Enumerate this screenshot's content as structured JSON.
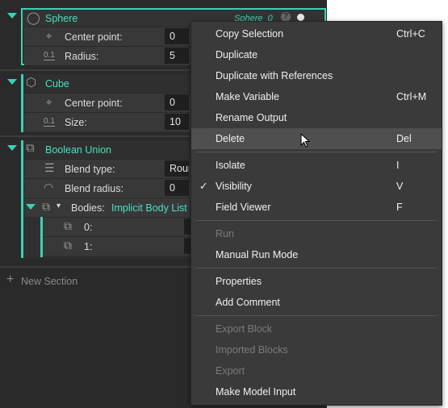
{
  "blocks": {
    "sphere": {
      "title": "Sphere",
      "output": "Sphere_0",
      "rows": [
        {
          "label": "Center point:",
          "value": "0"
        },
        {
          "label": "Radius:",
          "value": "5"
        }
      ]
    },
    "cube": {
      "title": "Cube",
      "rows": [
        {
          "label": "Center point:",
          "value": "0"
        },
        {
          "label": "Size:",
          "value": "10"
        }
      ]
    },
    "boolean": {
      "title": "Boolean Union",
      "rows": [
        {
          "label": "Blend type:",
          "value": "Roun"
        },
        {
          "label": "Blend radius:",
          "value": "0"
        }
      ],
      "bodies_label": "Bodies:",
      "bodies_type": "Implicit Body List",
      "items": [
        {
          "label": "0:"
        },
        {
          "label": "1:"
        }
      ]
    }
  },
  "small_label": "0.1",
  "new_section": "New Section",
  "menu": {
    "items": [
      {
        "label": "Copy Selection",
        "shortcut": "Ctrl+C"
      },
      {
        "label": "Duplicate",
        "shortcut": ""
      },
      {
        "label": "Duplicate with References",
        "shortcut": ""
      },
      {
        "label": "Make Variable",
        "shortcut": "Ctrl+M"
      },
      {
        "label": "Rename Output",
        "shortcut": ""
      },
      {
        "label": "Delete",
        "shortcut": "Del"
      },
      {
        "label": "Isolate",
        "shortcut": "I"
      },
      {
        "label": "Visibility",
        "shortcut": "V"
      },
      {
        "label": "Field Viewer",
        "shortcut": "F"
      },
      {
        "label": "Run",
        "shortcut": ""
      },
      {
        "label": "Manual Run Mode",
        "shortcut": ""
      },
      {
        "label": "Properties",
        "shortcut": ""
      },
      {
        "label": "Add Comment",
        "shortcut": ""
      },
      {
        "label": "Export Block",
        "shortcut": ""
      },
      {
        "label": "Imported Blocks",
        "shortcut": ""
      },
      {
        "label": "Export",
        "shortcut": ""
      },
      {
        "label": "Make Model Input",
        "shortcut": ""
      }
    ]
  },
  "colors": {
    "accent": "#3ed0b4",
    "highlight": "#4f4f4f"
  }
}
